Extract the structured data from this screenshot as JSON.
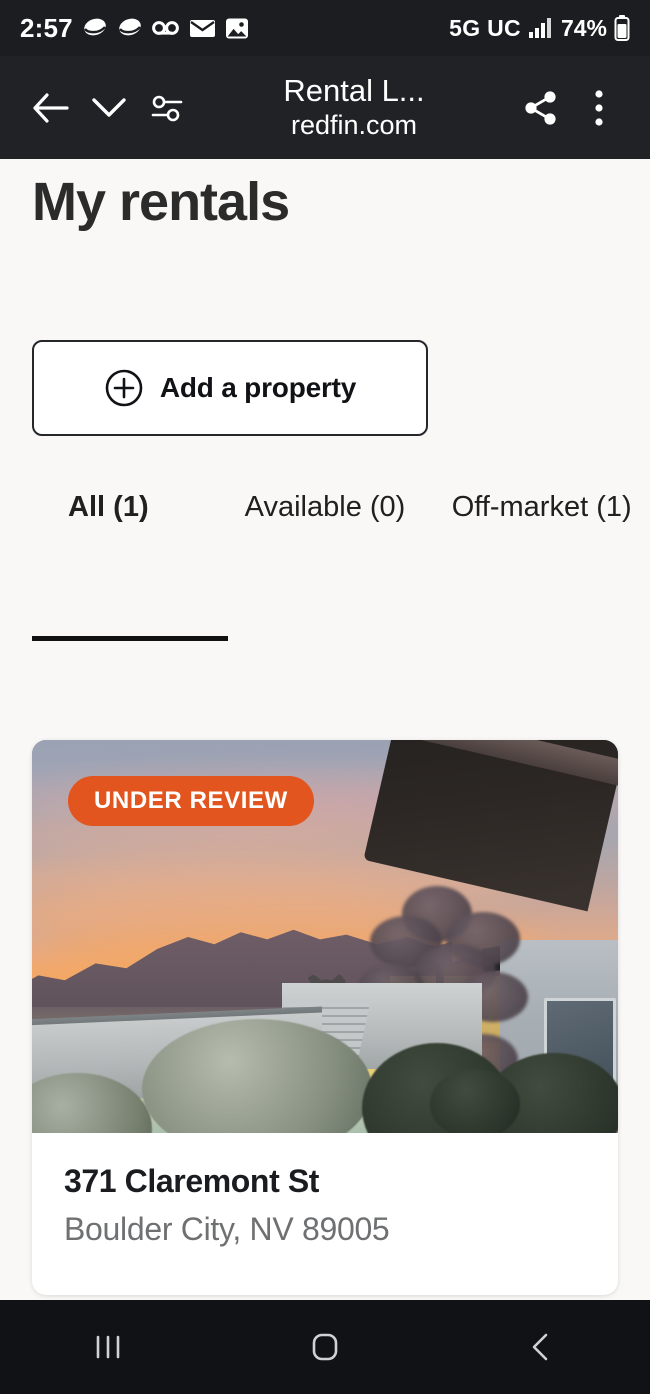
{
  "status_bar": {
    "time": "2:57",
    "network": "5G UC",
    "battery_percent": "74%",
    "left_icons": [
      "snapchat-icon",
      "snapchat-icon",
      "voicemail-icon",
      "mail-icon",
      "image-icon"
    ],
    "right_icons": [
      "signal-bars-icon",
      "battery-icon"
    ]
  },
  "browser_toolbar": {
    "back_icon": "back-arrow-icon",
    "dropdown_icon": "chevron-down-icon",
    "tune_icon": "page-settings-icon",
    "title": "Rental L...",
    "domain": "redfin.com",
    "share_icon": "share-icon",
    "overflow_icon": "more-vertical-icon"
  },
  "page": {
    "title": "My rentals",
    "add_property": {
      "label": "Add a property",
      "icon": "plus-circle-icon"
    },
    "tabs": [
      {
        "label": "All (1)",
        "active": true
      },
      {
        "label": "Available (0)",
        "active": false
      },
      {
        "label": "Off-market (1)",
        "active": false
      }
    ],
    "listings": [
      {
        "badge": "UNDER REVIEW",
        "badge_color": "#E2551E",
        "address_line1": "371 Claremont St",
        "address_line2": "Boulder City, NV 89005",
        "photo_alt": "desert-sunset-backyard-photo"
      }
    ]
  },
  "nav_bar": {
    "recents_icon": "recents-icon",
    "home_icon": "home-icon",
    "back_icon": "nav-back-icon"
  },
  "colors": {
    "background": "#F9F8F6",
    "toolbar": "#212226",
    "statusbar": "#1C1D21",
    "navbar": "#111216",
    "accent_orange": "#E2551E",
    "text_primary": "#1B1C20",
    "text_muted": "#6F7072"
  }
}
